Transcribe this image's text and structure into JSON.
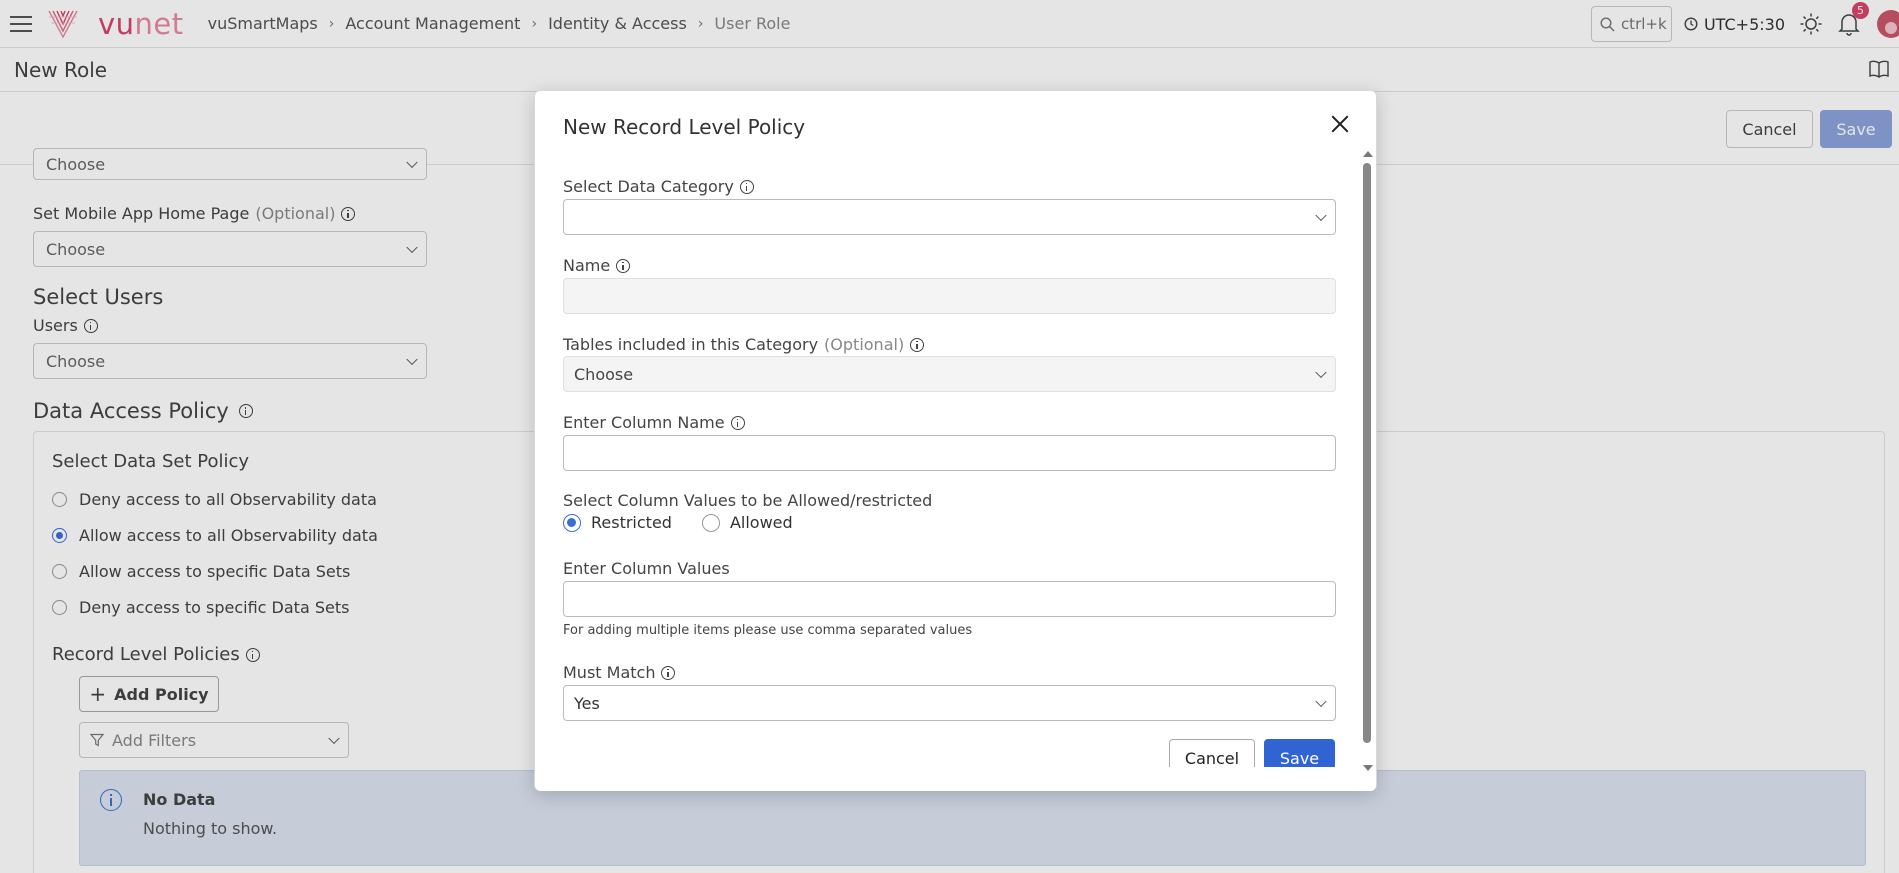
{
  "topbar": {
    "logo_text_a": "vu",
    "logo_text_b": "net",
    "breadcrumb": [
      "vuSmartMaps",
      "Account Management",
      "Identity & Access",
      "User Role"
    ],
    "search_shortcut": "ctrl+k",
    "timezone": "UTC+5:30",
    "notification_count": "5"
  },
  "page": {
    "title": "New Role",
    "cancel_label": "Cancel",
    "save_label": "Save"
  },
  "form": {
    "first_select_value": "Choose",
    "mobile_label": "Set Mobile App Home Page",
    "mobile_optional": "(Optional)",
    "mobile_value": "Choose",
    "select_users_title": "Select Users",
    "users_label": "Users",
    "users_value": "Choose",
    "data_access_title": "Data Access Policy",
    "data_set_policy_title": "Select Data Set Policy",
    "policies": [
      {
        "label": "Deny access to all Observability data",
        "checked": false
      },
      {
        "label": "Allow access to all Observability data",
        "checked": true
      },
      {
        "label": "Allow access to specific Data Sets",
        "checked": false
      },
      {
        "label": "Deny access to specific Data Sets",
        "checked": false
      }
    ],
    "record_level_title": "Record Level Policies",
    "add_policy_label": "Add Policy",
    "add_filters_placeholder": "Add Filters",
    "no_data_title": "No Data",
    "no_data_sub": "Nothing to show."
  },
  "modal": {
    "title": "New Record Level Policy",
    "data_category_label": "Select Data Category",
    "data_category_value": "",
    "name_label": "Name",
    "name_value": "",
    "tables_label": "Tables included in this Category",
    "tables_optional": "(Optional)",
    "tables_value": "Choose",
    "column_name_label": "Enter Column Name",
    "column_name_value": "",
    "column_values_mode_label": "Select Column Values to be Allowed/restricted",
    "mode_options": [
      {
        "label": "Restricted",
        "checked": true
      },
      {
        "label": "Allowed",
        "checked": false
      }
    ],
    "column_values_label": "Enter Column Values",
    "column_values_value": "",
    "column_values_hint": "For adding multiple items please use comma separated values",
    "must_match_label": "Must Match",
    "must_match_value": "Yes",
    "cancel_label": "Cancel",
    "save_label": "Save"
  },
  "colors": {
    "brand": "#d8456b",
    "primary": "#2f64d2",
    "primary_disabled": "#8ea3dc",
    "info_bg": "#dde4f1"
  }
}
